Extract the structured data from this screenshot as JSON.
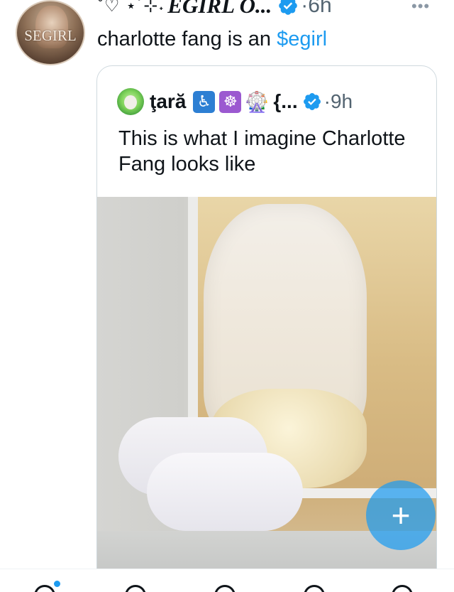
{
  "tweet": {
    "avatar_label": "SEGIRL",
    "sparkles": "˚♡ ⋆˙⊹˖",
    "display_name": "EGIRL O...",
    "separator": "·",
    "time": "6h",
    "more_label": "•••",
    "text_prefix": "charlotte fang is an ",
    "cashtag": "$egirl"
  },
  "quote": {
    "name": "ţară",
    "emojis": [
      "♿",
      "☸",
      "🎡"
    ],
    "truncated": "{...",
    "separator": "·",
    "time": "9h",
    "text": "This is what I imagine Charlotte Fang looks like"
  },
  "fab": {
    "label": "+"
  },
  "colors": {
    "accent": "#1d9bf0",
    "text_primary": "#0f1419",
    "text_secondary": "#536471",
    "border": "#cfd9de"
  },
  "icons": {
    "verified": "verified-badge-icon",
    "more": "more-icon",
    "compose": "compose-plus-icon"
  }
}
